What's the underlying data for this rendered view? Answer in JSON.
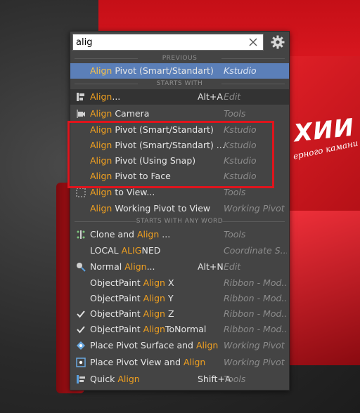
{
  "search": {
    "value": "alig"
  },
  "sections": {
    "previous": "PREVIOUS",
    "starts_with": "STARTS WITH",
    "any_word": "STARTS WITH ANY WORD"
  },
  "background": {
    "brand_big": "ХИИ",
    "brand_small": "ерного камани"
  },
  "colors": {
    "highlight": "#f0a020",
    "selection": "#5b7fb8",
    "annotation_box": "#e0141c",
    "panel": "#444444"
  },
  "rows": [
    {
      "pre": "",
      "hl": "Align",
      "post": " Pivot (Smart/Standart)",
      "shortcut": "",
      "category": "Kstudio",
      "icon": "none",
      "state": "selected"
    },
    {
      "pre": "",
      "hl": "Align",
      "post": "...",
      "shortcut": "Alt+A",
      "category": "Edit",
      "icon": "align-icon",
      "state": "hover"
    },
    {
      "pre": "",
      "hl": "Align",
      "post": " Camera",
      "shortcut": "",
      "category": "Tools",
      "icon": "camera-icon",
      "state": ""
    },
    {
      "pre": "",
      "hl": "Align",
      "post": " Pivot (Smart/Standart)",
      "shortcut": "",
      "category": "Kstudio",
      "icon": "none",
      "state": ""
    },
    {
      "pre": "",
      "hl": "Align",
      "post": " Pivot (Smart/Standart) ...",
      "shortcut": "",
      "category": "Kstudio",
      "icon": "none",
      "state": ""
    },
    {
      "pre": "",
      "hl": "Align",
      "post": " Pivot (Using Snap)",
      "shortcut": "",
      "category": "Kstudio",
      "icon": "none",
      "state": ""
    },
    {
      "pre": "",
      "hl": "Align",
      "post": " Pivot to Face",
      "shortcut": "",
      "category": "Kstudio",
      "icon": "none",
      "state": ""
    },
    {
      "pre": "",
      "hl": "Align",
      "post": " to View...",
      "shortcut": "",
      "category": "Tools",
      "icon": "align-view-icon",
      "state": ""
    },
    {
      "pre": "",
      "hl": "Align",
      "post": " Working Pivot to View",
      "shortcut": "",
      "category": "Working Pivot",
      "icon": "none",
      "state": ""
    },
    {
      "pre": "Clone and ",
      "hl": "Align",
      "post": " ...",
      "shortcut": "",
      "category": "Tools",
      "icon": "clone-align-icon",
      "state": ""
    },
    {
      "pre": "LOCAL ",
      "hl": "ALIG",
      "post": "NED",
      "shortcut": "",
      "category": "Coordinate S...",
      "icon": "none",
      "state": ""
    },
    {
      "pre": "Normal ",
      "hl": "Align",
      "post": "...",
      "shortcut": "Alt+N",
      "category": "Edit",
      "icon": "normal-align-icon",
      "state": ""
    },
    {
      "pre": "ObjectPaint ",
      "hl": "Align",
      "post": " X",
      "shortcut": "",
      "category": "Ribbon - Mod...",
      "icon": "none",
      "state": ""
    },
    {
      "pre": "ObjectPaint ",
      "hl": "Align",
      "post": " Y",
      "shortcut": "",
      "category": "Ribbon - Mod...",
      "icon": "none",
      "state": ""
    },
    {
      "pre": "ObjectPaint ",
      "hl": "Align",
      "post": " Z",
      "shortcut": "",
      "category": "Ribbon - Mod...",
      "icon": "check-icon",
      "state": ""
    },
    {
      "pre": "ObjectPaint ",
      "hl": "Align",
      "post": "ToNormal",
      "shortcut": "",
      "category": "Ribbon - Mod...",
      "icon": "check-icon",
      "state": ""
    },
    {
      "pre": "Place Pivot Surface and ",
      "hl": "Align",
      "post": "",
      "shortcut": "",
      "category": "Working Pivot",
      "icon": "pivot-surface-icon",
      "state": ""
    },
    {
      "pre": "Place Pivot View and ",
      "hl": "Align",
      "post": "",
      "shortcut": "",
      "category": "Working Pivot",
      "icon": "pivot-view-icon",
      "state": ""
    },
    {
      "pre": "Quick ",
      "hl": "Align",
      "post": "",
      "shortcut": "Shift+A",
      "category": "Tools",
      "icon": "quick-align-icon",
      "state": ""
    }
  ]
}
